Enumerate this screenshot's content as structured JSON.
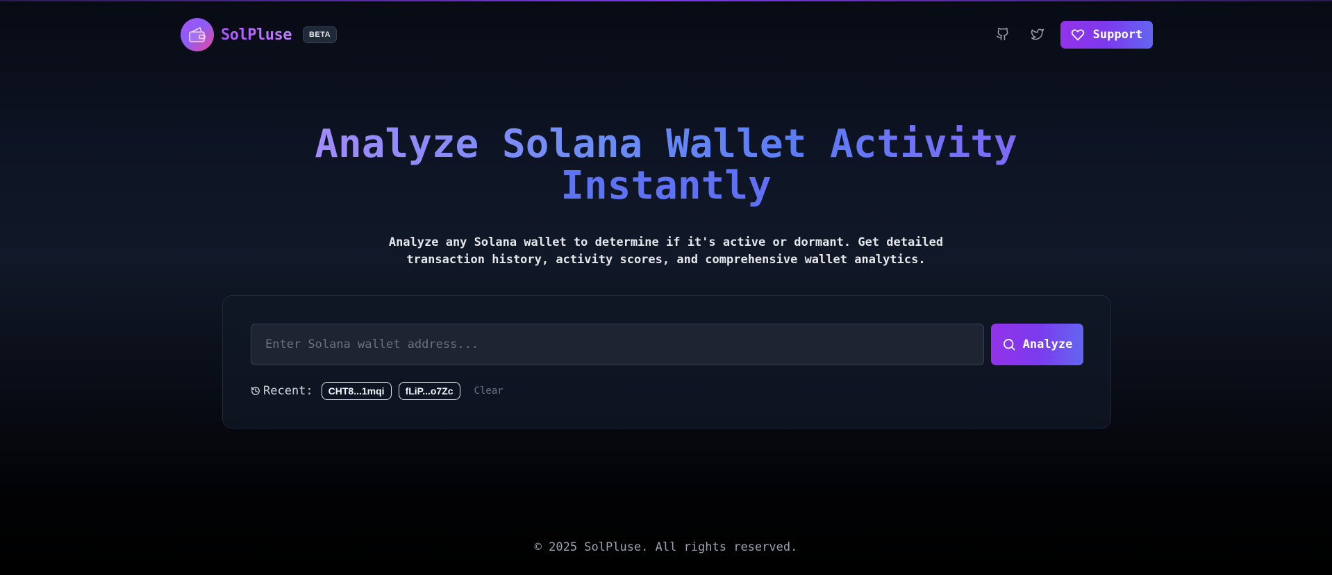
{
  "header": {
    "brand": "SolPluse",
    "badge": "BETA",
    "support_label": "Support",
    "icons": [
      "wallet-icon",
      "github-icon",
      "twitter-icon",
      "heart-icon"
    ]
  },
  "hero": {
    "title_line1": "Analyze Solana Wallet Activity",
    "title_line2": "Instantly",
    "subtitle_line1": "Analyze any Solana wallet to determine if it's active or dormant. Get detailed",
    "subtitle_line2": "transaction history, activity scores, and comprehensive wallet analytics."
  },
  "search": {
    "placeholder": "Enter Solana wallet address...",
    "value": "",
    "button_label": "Analyze",
    "recent_label": "Recent:",
    "recent_items": [
      "CHT8...1mqi",
      "fLiP...o7Zc"
    ],
    "clear_label": "Clear"
  },
  "footer": {
    "text": "© 2025 SolPluse. All rights reserved."
  },
  "colors": {
    "accent_start": "#9333ea",
    "accent_end": "#6366f1",
    "background": "#0e1525"
  }
}
